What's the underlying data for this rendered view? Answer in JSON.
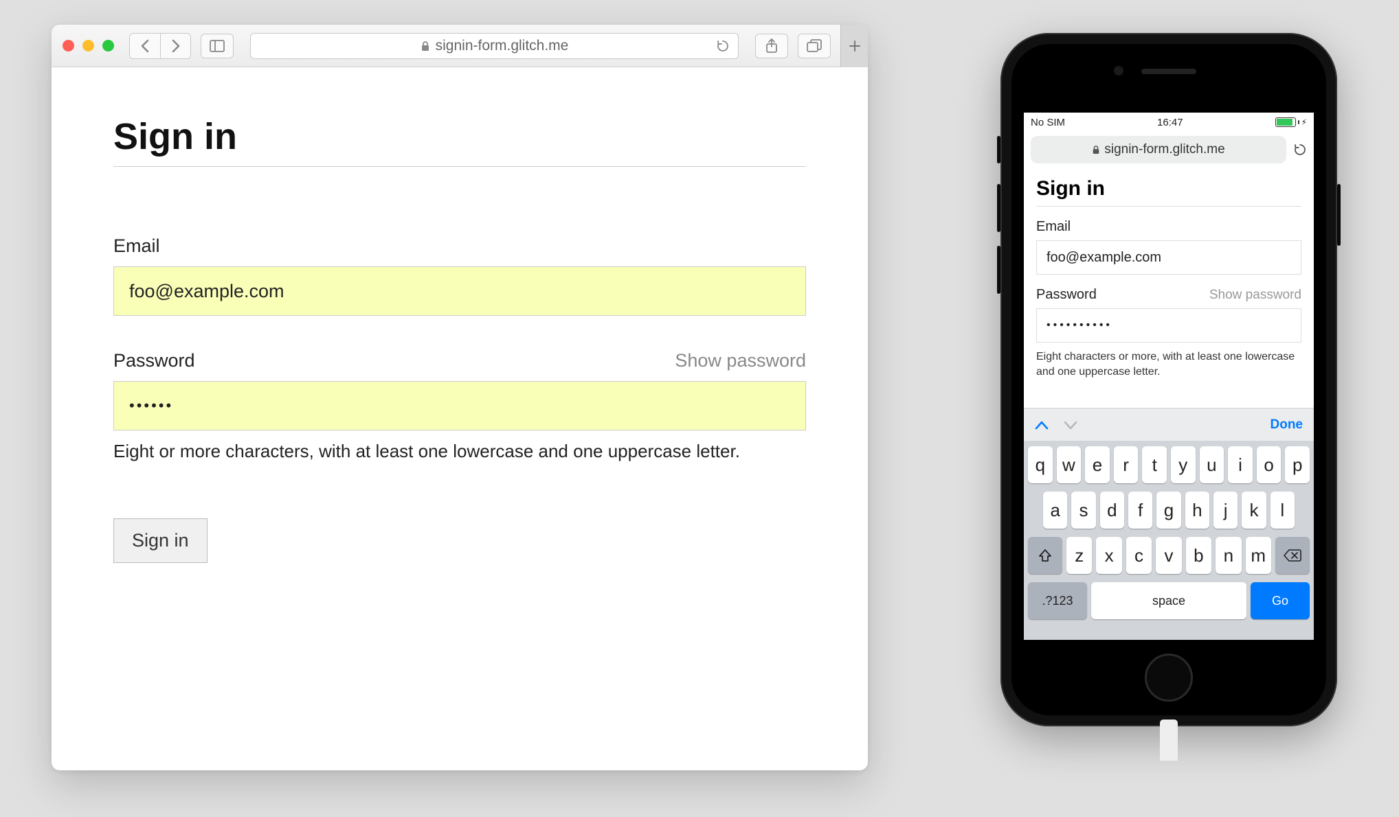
{
  "safari": {
    "url_display": "signin-form.glitch.me"
  },
  "form": {
    "title": "Sign in",
    "email_label": "Email",
    "email_value": "foo@example.com",
    "password_label": "Password",
    "show_password": "Show password",
    "password_value": "••••••",
    "password_hint": "Eight or more characters, with at least one lowercase and one uppercase letter.",
    "submit": "Sign in"
  },
  "iphone": {
    "status": {
      "carrier": "No SIM",
      "time": "16:47"
    },
    "url_display": "signin-form.glitch.me",
    "form": {
      "title": "Sign in",
      "email_label": "Email",
      "email_value": "foo@example.com",
      "password_label": "Password",
      "show_password": "Show password",
      "password_value": "••••••••••",
      "password_hint": "Eight characters or more, with at least one lowercase and one uppercase letter."
    },
    "keyboard": {
      "done": "Done",
      "row1": [
        "q",
        "w",
        "e",
        "r",
        "t",
        "y",
        "u",
        "i",
        "o",
        "p"
      ],
      "row2": [
        "a",
        "s",
        "d",
        "f",
        "g",
        "h",
        "j",
        "k",
        "l"
      ],
      "row3": [
        "z",
        "x",
        "c",
        "v",
        "b",
        "n",
        "m"
      ],
      "numbers_key": ".?123",
      "space": "space",
      "go": "Go"
    }
  }
}
